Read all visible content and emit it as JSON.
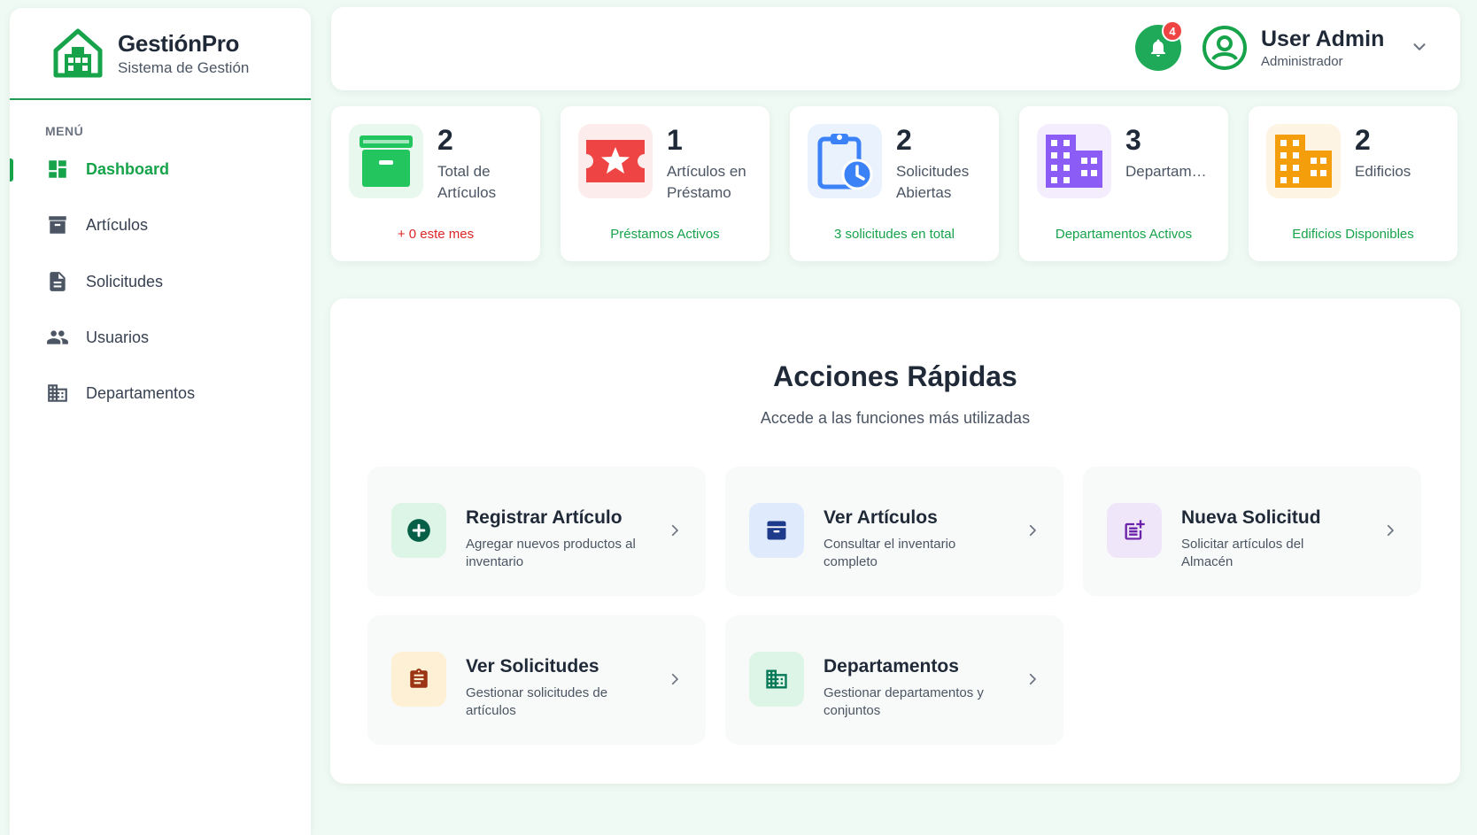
{
  "brand": {
    "title": "GestiónPro",
    "subtitle": "Sistema de Gestión",
    "logo": "house-logo-icon"
  },
  "sidebar": {
    "menu_label": "MENÚ",
    "items": [
      {
        "label": "Dashboard",
        "icon": "dashboard-icon",
        "active": true
      },
      {
        "label": "Artículos",
        "icon": "archive-icon",
        "active": false
      },
      {
        "label": "Solicitudes",
        "icon": "document-icon",
        "active": false
      },
      {
        "label": "Usuarios",
        "icon": "users-icon",
        "active": false
      },
      {
        "label": "Departamentos",
        "icon": "building-icon",
        "active": false
      }
    ]
  },
  "header": {
    "notifications_count": "4",
    "user_name": "User Admin",
    "user_role": "Administrador"
  },
  "stats": [
    {
      "value": "2",
      "label": "Total de Artículos",
      "footer": "+ 0 este mes",
      "color": "#22c55e",
      "icon": "archive-icon"
    },
    {
      "value": "1",
      "label": "Artículos en Préstamo",
      "footer": "Préstamos Activos",
      "color": "#ef4444",
      "icon": "ticket-star-icon"
    },
    {
      "value": "2",
      "label": "Solicitudes Abiertas",
      "footer": "3 solicitudes en total",
      "color": "#3b82f6",
      "icon": "clipboard-clock-icon"
    },
    {
      "value": "3",
      "label": "Departamentos",
      "footer": "Departamentos Activos",
      "color": "#8b5cf6",
      "icon": "building-icon"
    },
    {
      "value": "2",
      "label": "Edificios",
      "footer": "Edificios Disponibles",
      "color": "#f59e0b",
      "icon": "building-icon"
    }
  ],
  "quick_actions": {
    "title": "Acciones Rápidas",
    "subtitle": "Accede a las funciones más utilizadas",
    "items": [
      {
        "title": "Registrar Artículo",
        "desc": "Agregar nuevos productos al inventario",
        "icon": "plus-circle-icon"
      },
      {
        "title": "Ver Artículos",
        "desc": "Consultar el inventario completo",
        "icon": "archive-icon"
      },
      {
        "title": "Nueva Solicitud",
        "desc": "Solicitar artículos del Almacén",
        "icon": "post-add-icon"
      },
      {
        "title": "Ver Solicitudes",
        "desc": "Gestionar solicitudes de artículos",
        "icon": "clipboard-icon"
      },
      {
        "title": "Departamentos",
        "desc": "Gestionar departamentos y conjuntos",
        "icon": "building-icon"
      }
    ]
  },
  "colors": {
    "primary": "#16a34a",
    "background": "#eefaf3"
  }
}
